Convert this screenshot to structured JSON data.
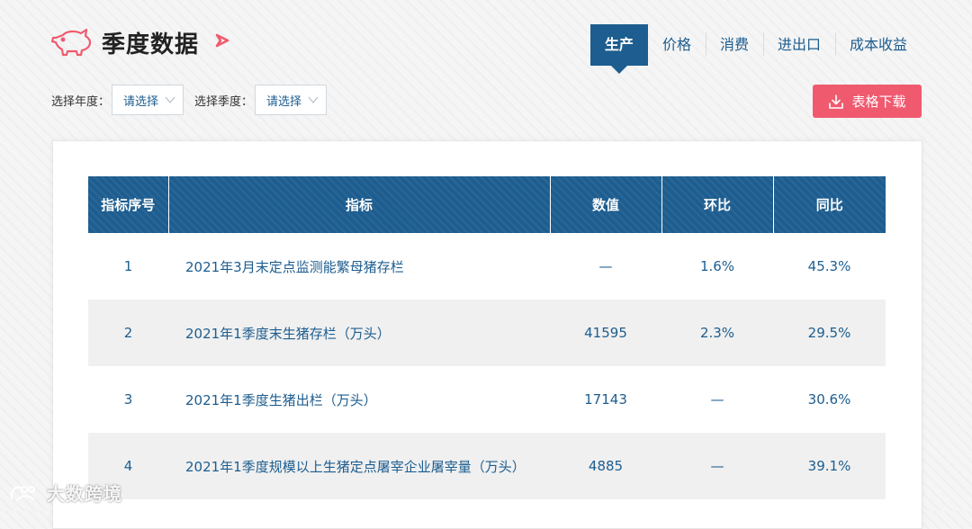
{
  "header": {
    "title": "季度数据",
    "icons": {
      "logo": "pig-icon",
      "title_marker": "arrow-right-icon"
    },
    "tabs": [
      {
        "label": "生产",
        "active": true
      },
      {
        "label": "价格",
        "active": false
      },
      {
        "label": "消费",
        "active": false
      },
      {
        "label": "进出口",
        "active": false
      },
      {
        "label": "成本收益",
        "active": false
      }
    ]
  },
  "filters": {
    "year_label": "选择年度：",
    "year_value": "请选择",
    "quarter_label": "选择季度：",
    "quarter_value": "请选择"
  },
  "download": {
    "label": "表格下载",
    "icon": "download-icon"
  },
  "table": {
    "headers": [
      "指标序号",
      "指标",
      "数值",
      "环比",
      "同比"
    ],
    "rows": [
      {
        "index": "1",
        "name": "2021年3月末定点监测能繁母猪存栏",
        "value": "—",
        "mom": "1.6%",
        "yoy": "45.3%"
      },
      {
        "index": "2",
        "name": "2021年1季度末生猪存栏（万头）",
        "value": "41595",
        "mom": "2.3%",
        "yoy": "29.5%"
      },
      {
        "index": "3",
        "name": "2021年1季度生猪出栏（万头）",
        "value": "17143",
        "mom": "—",
        "yoy": "30.6%"
      },
      {
        "index": "4",
        "name": "2021年1季度规模以上生猪定点屠宰企业屠宰量（万头）",
        "value": "4885",
        "mom": "—",
        "yoy": "39.1%"
      }
    ]
  },
  "watermark": {
    "text": "大数跨境",
    "icon": "watermark-logo-icon"
  },
  "colors": {
    "primary": "#1d5d8f",
    "accent": "#f05a6f",
    "row_alt": "#f0f0f0"
  }
}
